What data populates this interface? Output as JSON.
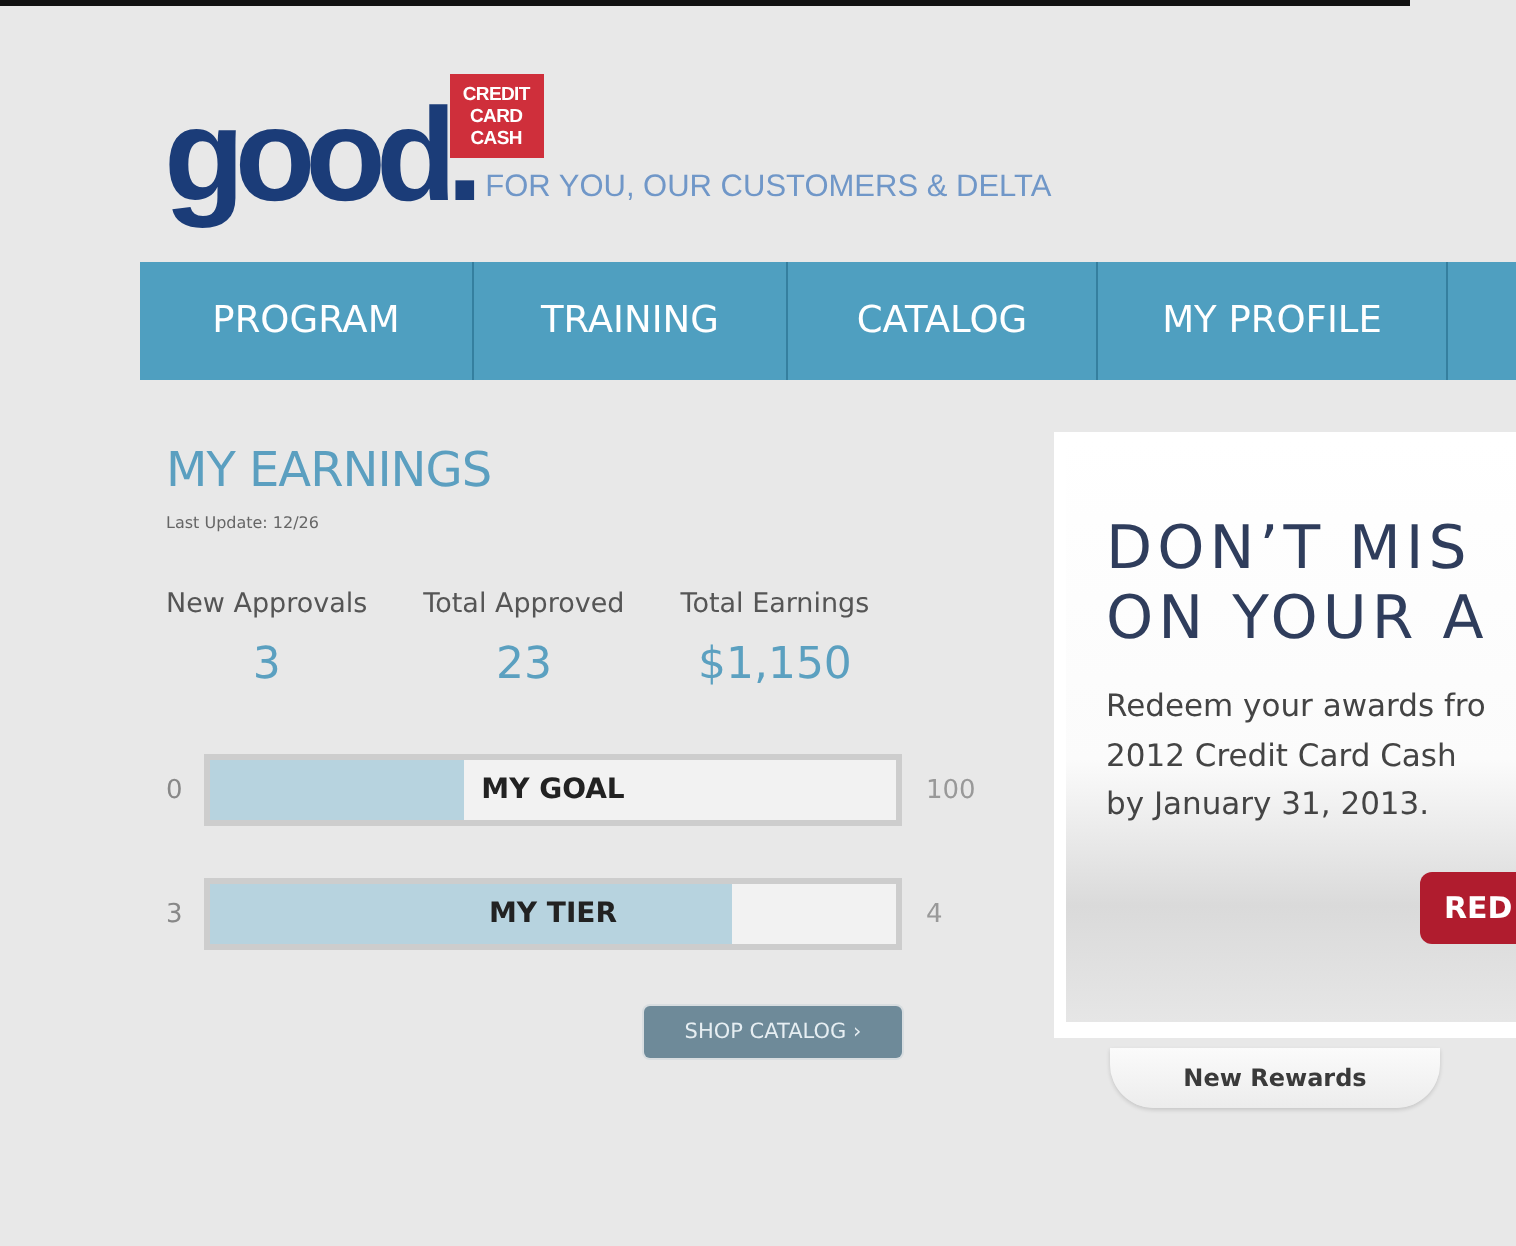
{
  "header": {
    "logo": "good.",
    "badge_lines": [
      "CREDIT",
      "CARD",
      "CASH"
    ],
    "tagline": "FOR YOU, OUR CUSTOMERS & DELTA"
  },
  "nav": {
    "items": [
      "PROGRAM",
      "TRAINING",
      "CATALOG",
      "MY PROFILE"
    ]
  },
  "earnings": {
    "title": "MY EARNINGS",
    "last_update": "Last Update: 12/26",
    "stats": [
      {
        "label": "New Approvals",
        "value": "3"
      },
      {
        "label": "Total Approved",
        "value": "23"
      },
      {
        "label": "Total Earnings",
        "value": "$1,150"
      }
    ],
    "meters": [
      {
        "label": "MY GOAL",
        "min": "0",
        "max": "100",
        "level": 0.37
      },
      {
        "label": "MY TIER",
        "min": "3",
        "max": "4",
        "level": 0.76
      }
    ],
    "button": "SHOP CATALOG ›"
  },
  "promo": {
    "heading_lines": [
      "DON’T MIS",
      "ON YOUR A"
    ],
    "body_lines": [
      "Redeem your awards fro",
      "2012 Credit Card Cash",
      "by January 31, 2013."
    ],
    "button": "RED"
  },
  "promo_tabs": [
    {
      "label": "New Rewards",
      "selected": true
    }
  ]
}
